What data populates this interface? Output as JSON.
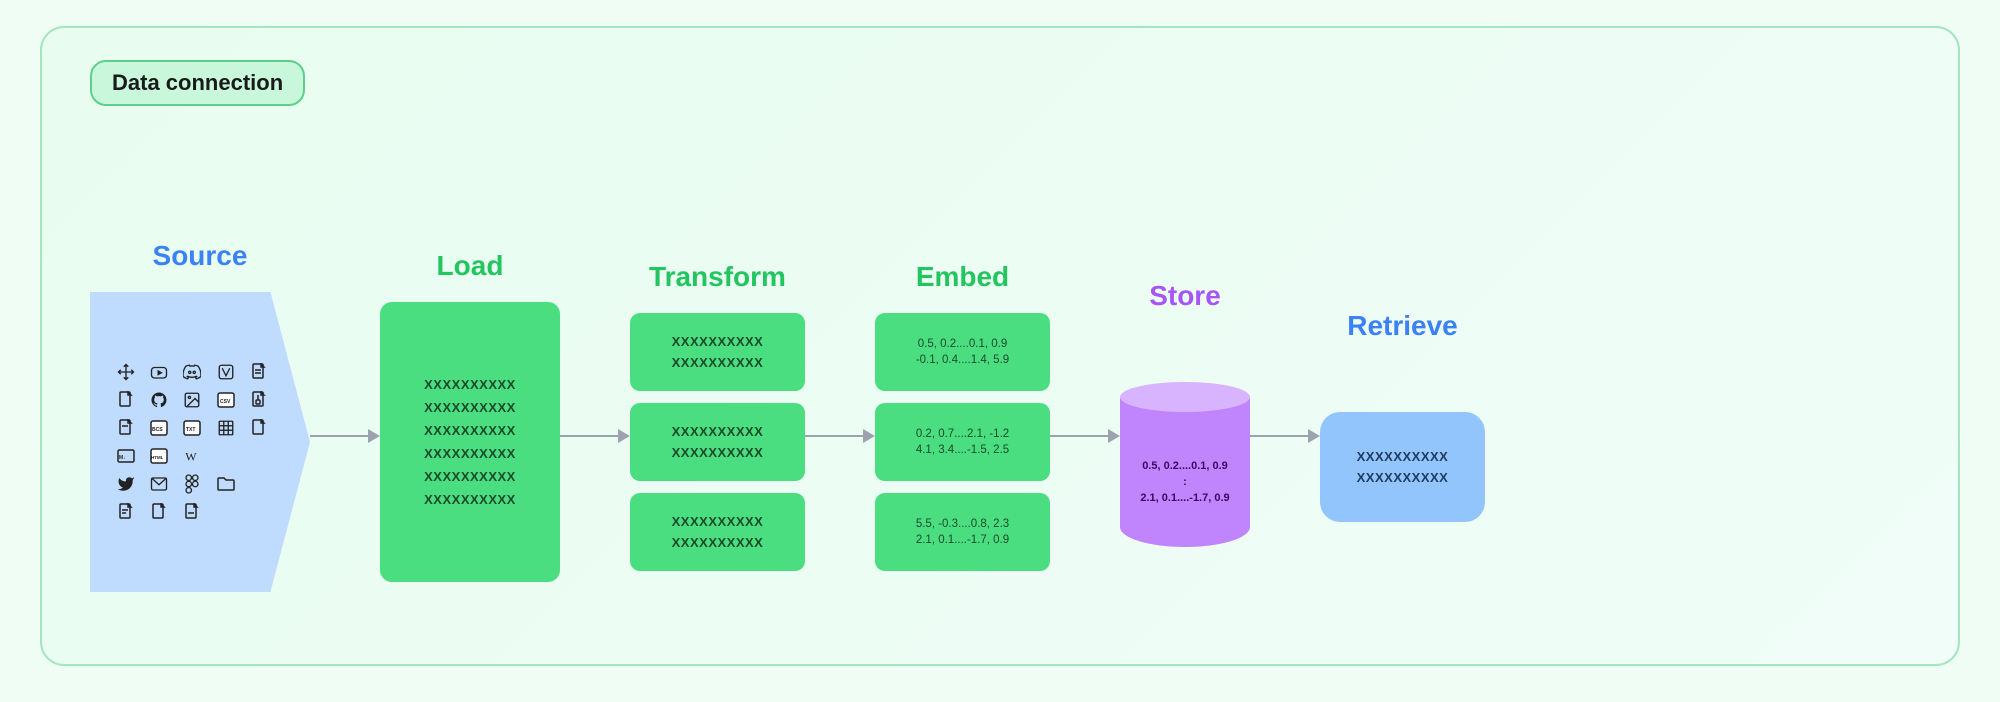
{
  "title": "Data connection",
  "stages": {
    "source": {
      "label": "Source",
      "color": "blue"
    },
    "load": {
      "label": "Load",
      "color": "green",
      "rows": [
        "XXXXXXXXXX",
        "XXXXXXXXXX",
        "XXXXXXXXXX",
        "XXXXXXXXXX",
        "XXXXXXXXXX",
        "XXXXXXXXXX"
      ]
    },
    "transform": {
      "label": "Transform",
      "color": "green",
      "boxes": [
        {
          "rows": [
            "XXXXXXXXXX",
            "XXXXXXXXXX"
          ]
        },
        {
          "rows": [
            "XXXXXXXXXX",
            "XXXXXXXXXX"
          ]
        },
        {
          "rows": [
            "XXXXXXXXXX",
            "XXXXXXXXXX"
          ]
        }
      ]
    },
    "embed": {
      "label": "Embed",
      "color": "green",
      "boxes": [
        {
          "line1": "0.5, 0.2....0.1, 0.9",
          "line2": "-0.1, 0.4....1.4, 5.9"
        },
        {
          "line1": "0.2, 0.7....2.1, -1.2",
          "line2": "4.1, 3.4....-1.5, 2.5"
        },
        {
          "line1": "5.5, -0.3....0.8, 2.3",
          "line2": "2.1, 0.1....-1.7, 0.9"
        }
      ]
    },
    "store": {
      "label": "Store",
      "color": "purple",
      "line1": "0.5, 0.2....0.1, 0.9",
      "separator": ":",
      "line2": "2.1, 0.1....-1.7, 0.9"
    },
    "retrieve": {
      "label": "Retrieve",
      "color": "blue",
      "rows": [
        "XXXXXXXXXX",
        "XXXXXXXXXX"
      ]
    }
  },
  "icons": [
    "⊞",
    "▶",
    "◈",
    "▲",
    "◻",
    "◻",
    "◯",
    "◻",
    "◻",
    "◻",
    "◻",
    "◻",
    "◻",
    "◻",
    "◻",
    "◻",
    "◻",
    "◻",
    "◻",
    "◻",
    "◻",
    "◻",
    "◻",
    "◻",
    "◻"
  ]
}
